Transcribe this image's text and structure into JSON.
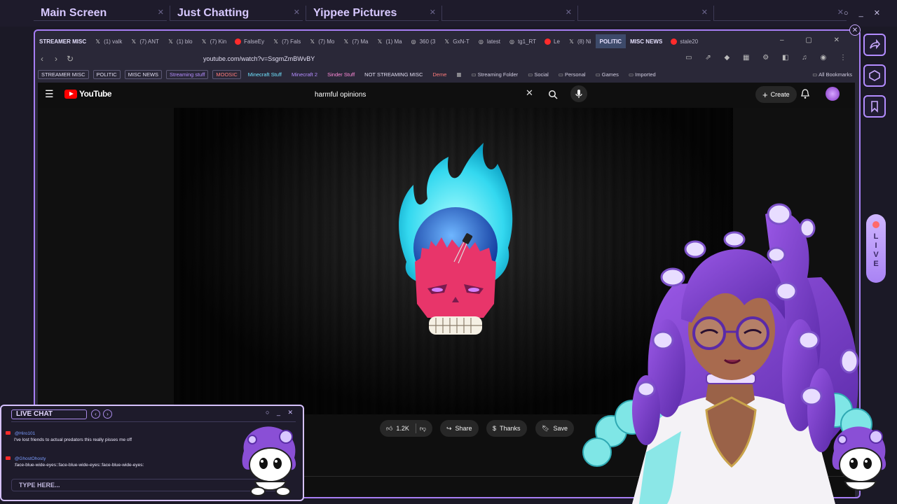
{
  "overlay": {
    "tabs": [
      "Main Screen",
      "Just Chatting",
      "Yippee Pictures"
    ],
    "window_controls": "○ _ ✕",
    "live_letters": [
      "L",
      "I",
      "V",
      "E"
    ]
  },
  "browser": {
    "tabs": [
      {
        "label": "STREAMER MISC",
        "kind": "group"
      },
      {
        "label": "(1) valk",
        "kind": "x"
      },
      {
        "label": "(7) ANT",
        "kind": "x"
      },
      {
        "label": "(1) blo",
        "kind": "x"
      },
      {
        "label": "(7) Kin",
        "kind": "x"
      },
      {
        "label": "FalseEy",
        "kind": "yt"
      },
      {
        "label": "(7) Fals",
        "kind": "x"
      },
      {
        "label": "(7) Mo",
        "kind": "x"
      },
      {
        "label": "(7) Ma",
        "kind": "x"
      },
      {
        "label": "(1) Ma",
        "kind": "x"
      },
      {
        "label": "360 (3",
        "kind": "other"
      },
      {
        "label": "GxN-T",
        "kind": "x"
      },
      {
        "label": "latest",
        "kind": "other"
      },
      {
        "label": "tg1_RT",
        "kind": "other"
      },
      {
        "label": "Le",
        "kind": "yt"
      },
      {
        "label": "(8) Ni",
        "kind": "x"
      },
      {
        "label": "POLITIC",
        "kind": "group2"
      },
      {
        "label": "MISC NEWS",
        "kind": "group"
      },
      {
        "label": "stale20",
        "kind": "yt"
      }
    ],
    "url": "youtube.com/watch?v=SsgmZmBWvBY",
    "bookmarks": [
      {
        "label": "STREAMER MISC",
        "color": "#e0dcf0",
        "boxed": true
      },
      {
        "label": "POLITIC",
        "color": "#e0dcf0",
        "boxed": true
      },
      {
        "label": "MISC NEWS",
        "color": "#e0dcf0",
        "boxed": true
      },
      {
        "label": "Streaming stuff",
        "color": "#b58cff",
        "boxed": true
      },
      {
        "label": "MOOSIC",
        "color": "#ff7b7b",
        "boxed": true
      },
      {
        "label": "Minecraft Stuff",
        "color": "#6fe3ff",
        "boxed": false
      },
      {
        "label": "Minecraft 2",
        "color": "#b58cff",
        "boxed": false
      },
      {
        "label": "Sinder Stuff",
        "color": "#ff8ad8",
        "boxed": false
      },
      {
        "label": "NOT STREAMING MISC",
        "color": "#e0dcf0",
        "boxed": false
      },
      {
        "label": "Deme",
        "color": "#ff7b7b",
        "boxed": false
      }
    ],
    "bookmark_folders": [
      "Streaming Folder",
      "Social",
      "Personal",
      "Games",
      "Imported"
    ],
    "all_bookmarks": "All Bookmarks"
  },
  "youtube": {
    "logo": "YouTube",
    "search_value": "harmful opinions",
    "create_label": "Create",
    "like_count": "1.2K",
    "share_label": "Share",
    "thanks_label": "Thanks",
    "save_label": "Save"
  },
  "chat": {
    "title": "LIVE CHAT",
    "controls": "○ _ ✕",
    "messages": [
      {
        "user": "@Hiro101",
        "text": "I've lost friends to actual predators this really pisses me off"
      },
      {
        "user": "@GhostOhosty",
        "text": ":face-blue-wide-eyes::face-blue-wide-eyes::face-blue-wide-eyes:"
      }
    ],
    "input_placeholder": "TYPE HERE..."
  },
  "colors": {
    "accent": "#a77ef4",
    "youtube_red": "#ff0000",
    "overlay_bg": "#1e1b2b"
  }
}
